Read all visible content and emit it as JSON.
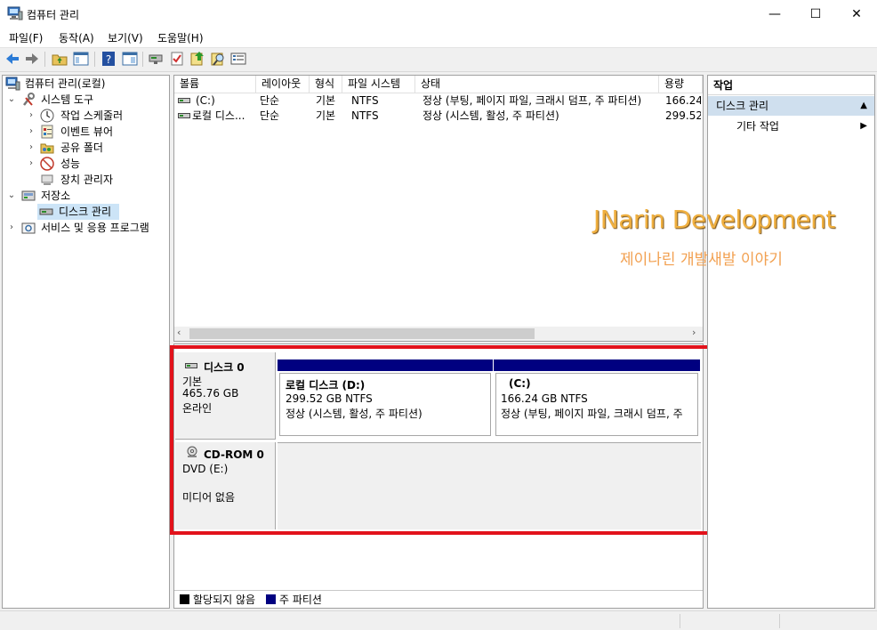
{
  "window": {
    "title": "컴퓨터 관리",
    "minimize": "—",
    "maximize": "☐",
    "close": "✕"
  },
  "menu": [
    "파일(F)",
    "동작(A)",
    "보기(V)",
    "도움말(H)"
  ],
  "toolbar_icons": [
    "back-icon",
    "forward-icon",
    "up-folder-icon",
    "show-hide-tree-icon",
    "help-icon",
    "properties-icon",
    "connect-icon",
    "check-icon",
    "export-icon",
    "find-icon",
    "list-icon"
  ],
  "tree": {
    "root": "컴퓨터 관리(로컬)",
    "system_tools": "시스템 도구",
    "task_scheduler": "작업 스케줄러",
    "event_viewer": "이벤트 뷰어",
    "shared_folders": "공유 폴더",
    "performance": "성능",
    "device_manager": "장치 관리자",
    "storage": "저장소",
    "disk_management": "디스크 관리",
    "services": "서비스 및 응용 프로그램"
  },
  "volume_list": {
    "columns": [
      "볼륨",
      "레이아웃",
      "형식",
      "파일 시스템",
      "상태",
      "용량"
    ],
    "rows": [
      [
        "(C:)",
        "단순",
        "기본",
        "NTFS",
        "정상 (부팅, 페이지 파일, 크래시 덤프, 주 파티션)",
        "166.24"
      ],
      [
        "로컬 디스...",
        "단순",
        "기본",
        "NTFS",
        "정상 (시스템, 활성, 주 파티션)",
        "299.52"
      ]
    ]
  },
  "disks": {
    "disk0": {
      "name": "디스크 0",
      "type": "기본",
      "size": "465.76 GB",
      "status": "온라인",
      "volumes": [
        {
          "name": "로컬 디스크  (D:)",
          "size": "299.52 GB NTFS",
          "status": "정상 (시스템, 활성, 주 파티션)"
        },
        {
          "name": "(C:)",
          "size": "166.24 GB NTFS",
          "status": "정상 (부팅, 페이지 파일, 크래시 덤프, 주"
        }
      ]
    },
    "cdrom0": {
      "name": "CD-ROM 0",
      "type": "DVD (E:)",
      "status": "미디어 없음"
    }
  },
  "legend": {
    "unallocated": "할당되지 않음",
    "primary": "주 파티션",
    "unallocated_color": "#000000",
    "primary_color": "#000080"
  },
  "actions": {
    "title": "작업",
    "section": "디스크 관리",
    "more": "기타 작업"
  },
  "watermark": {
    "line1": "JNarin Development",
    "line2": "제이나린 개발새발 이야기"
  },
  "colors": {
    "highlight_red": "#e2121b",
    "volume_bar": "#000080",
    "actions_section_bg": "#cfdfee"
  }
}
